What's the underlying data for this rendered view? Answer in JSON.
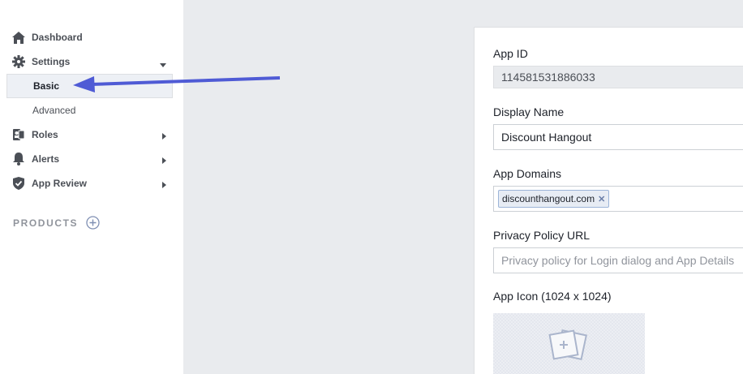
{
  "sidebar": {
    "items": [
      {
        "label": "Dashboard",
        "icon": "home-icon"
      },
      {
        "label": "Settings",
        "icon": "gear-icon"
      },
      {
        "label": "Roles",
        "icon": "roles-icon"
      },
      {
        "label": "Alerts",
        "icon": "bell-icon"
      },
      {
        "label": "App Review",
        "icon": "shield-icon"
      }
    ],
    "settings_sub": [
      {
        "label": "Basic",
        "active": true
      },
      {
        "label": "Advanced",
        "active": false
      }
    ],
    "products_label": "PRODUCTS"
  },
  "form": {
    "app_id_label": "App ID",
    "app_id_value": "114581531886033",
    "display_name_label": "Display Name",
    "display_name_value": "Discount Hangout",
    "app_domains_label": "App Domains",
    "app_domains": [
      "discounthangout.com"
    ],
    "privacy_label": "Privacy Policy URL",
    "privacy_placeholder": "Privacy policy for Login dialog and App Details",
    "app_icon_label": "App Icon (1024 x 1024)"
  },
  "colors": {
    "accent": "#4f5bd5",
    "sidebar_bg": "#ffffff",
    "page_bg": "#e9ebee"
  }
}
